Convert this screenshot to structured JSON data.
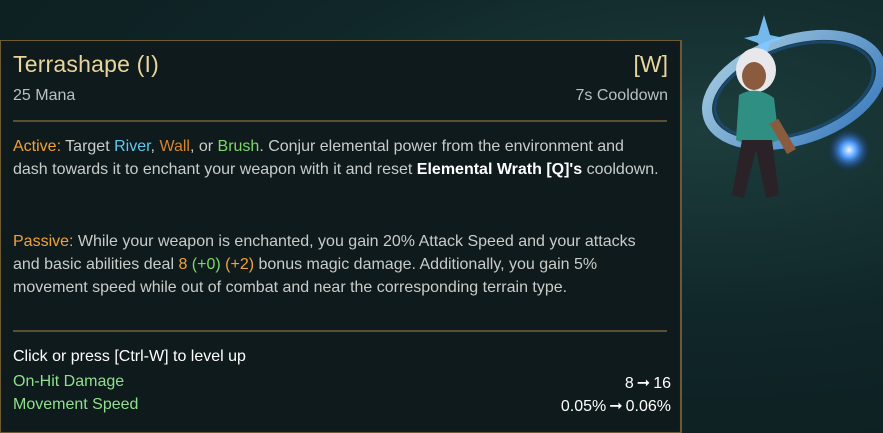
{
  "ability": {
    "name": "Terrashape (I)",
    "hotkey": "[W]",
    "cost": "25 Mana",
    "cooldown": "7s Cooldown"
  },
  "active": {
    "label": "Active:",
    "t1": " Target ",
    "river": "River",
    "t2": ", ",
    "wall": "Wall",
    "t3": ", or ",
    "brush": "Brush",
    "t4": ". Conjur elemental power from the environment and dash towards it to enchant your weapon with it and reset ",
    "bold": "Elemental Wrath [Q]'s",
    "t5": " cooldown."
  },
  "passive": {
    "label": "Passive:",
    "t1": " While your weapon is enchanted, you gain 20% Attack Speed and your attacks and basic abilities deal ",
    "dmg": "8",
    "ad": "(+0)",
    "ap": "(+2)",
    "t2": " bonus magic damage. Additionally, you gain 5% movement speed while out of combat and near the corresponding terrain type."
  },
  "levelup": "Click or press [Ctrl-W] to level up",
  "stats": [
    {
      "label": "On-Hit Damage",
      "from": "8",
      "to": "16"
    },
    {
      "label": "Movement Speed",
      "from": "0.05%",
      "to": "0.06%"
    }
  ],
  "colors": {
    "title": "#e8d59c",
    "active_keyword": "#f0a23c",
    "river": "#5fc9ee",
    "wall": "#d6852f",
    "brush": "#7ed86a",
    "stat_label": "#8fe08c",
    "border": "#6d5a33"
  }
}
